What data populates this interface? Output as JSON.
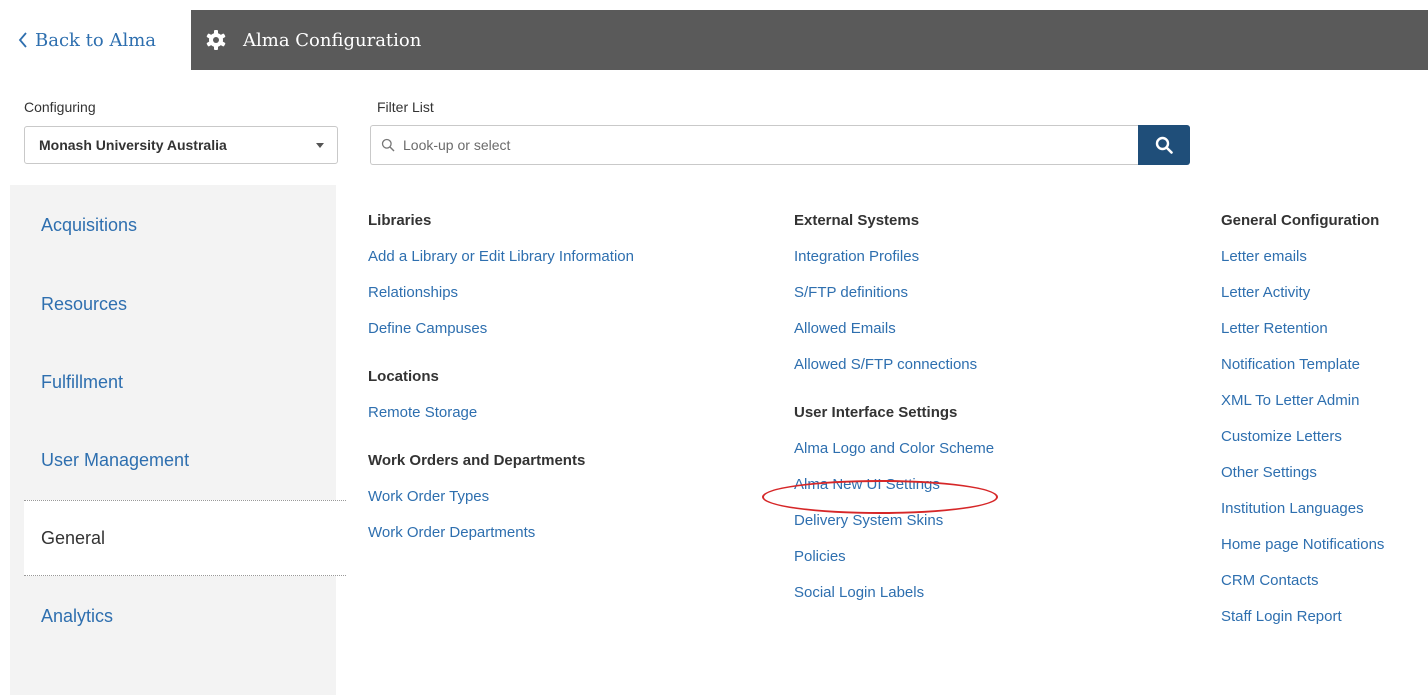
{
  "header": {
    "back_label": "Back to Alma",
    "title": "Alma Configuration",
    "colors": {
      "bar": "#5a5a5a",
      "link": "#2e6faf",
      "search_button": "#1f4e79",
      "highlight": "#d62728"
    }
  },
  "configuring": {
    "label": "Configuring",
    "value": "Monash University Australia"
  },
  "filter": {
    "label": "Filter List",
    "placeholder": "Look-up or select"
  },
  "sidebar": {
    "items": [
      {
        "label": "Acquisitions"
      },
      {
        "label": "Resources"
      },
      {
        "label": "Fulfillment"
      },
      {
        "label": "User Management"
      },
      {
        "label": "General",
        "active": true
      },
      {
        "label": "Analytics"
      }
    ]
  },
  "columns": {
    "col1": {
      "libraries": {
        "heading": "Libraries",
        "links": [
          "Add a Library or Edit Library Information",
          "Relationships",
          "Define Campuses"
        ]
      },
      "locations": {
        "heading": "Locations",
        "links": [
          "Remote Storage"
        ]
      },
      "work_orders": {
        "heading": "Work Orders and Departments",
        "links": [
          "Work Order Types",
          "Work Order Departments"
        ]
      }
    },
    "col2": {
      "external": {
        "heading": "External Systems",
        "links": [
          "Integration Profiles",
          "S/FTP definitions",
          "Allowed Emails",
          "Allowed S/FTP connections"
        ]
      },
      "ui_settings": {
        "heading": "User Interface Settings",
        "links": [
          "Alma Logo and Color Scheme",
          "Alma New UI Settings",
          "Delivery System Skins",
          "Policies",
          "Social Login Labels"
        ],
        "highlighted": "Alma New UI Settings"
      }
    },
    "col3": {
      "general": {
        "heading": "General Configuration",
        "links": [
          "Letter emails",
          "Letter Activity",
          "Letter Retention",
          "Notification Template",
          "XML To Letter Admin",
          "Customize Letters",
          "Other Settings",
          "Institution Languages",
          "Home page Notifications",
          "CRM Contacts",
          "Staff Login Report"
        ]
      }
    }
  }
}
